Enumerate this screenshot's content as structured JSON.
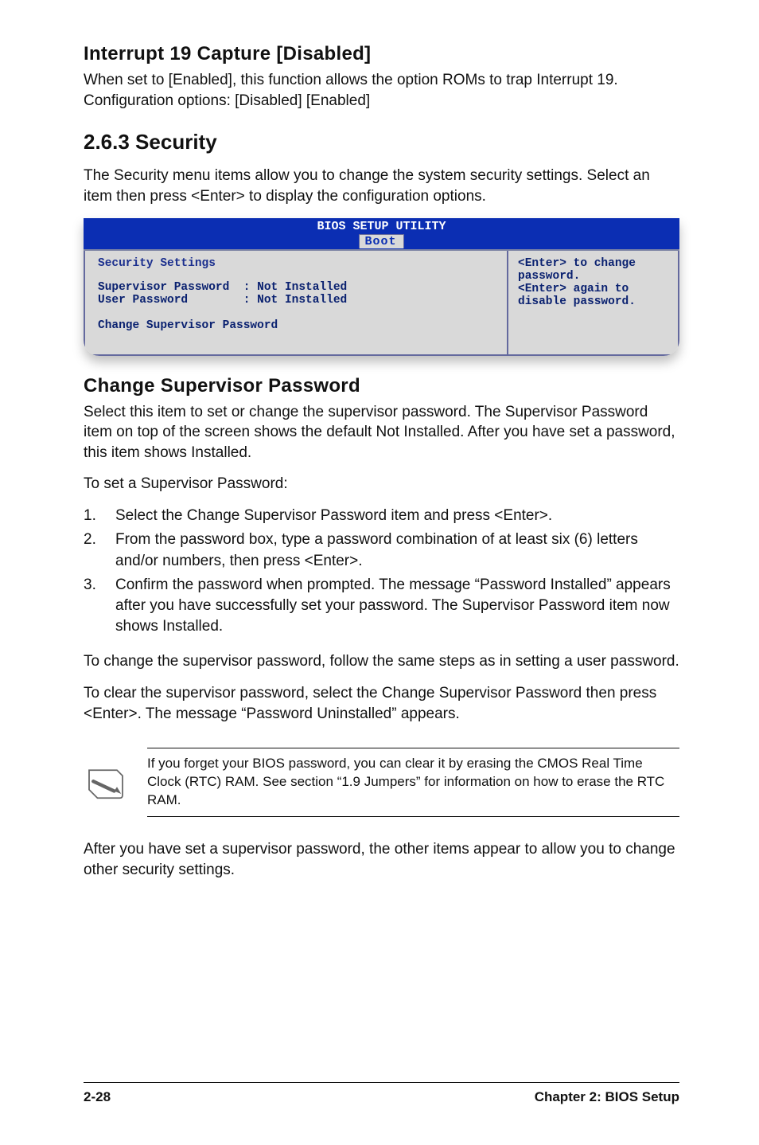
{
  "section1": {
    "heading": "Interrupt 19 Capture [Disabled]",
    "para": "When set to [Enabled], this function allows the option ROMs to trap Interrupt 19. Configuration options: [Disabled] [Enabled]"
  },
  "section2_heading": "2.6.3    Security",
  "section2_para": "The Security menu items allow you to change the system security settings. Select an item then press <Enter> to display the configuration options.",
  "bios": {
    "title": "BIOS SETUP UTILITY",
    "tab": "Boot",
    "left_title": "Security Settings",
    "row1": "Supervisor Password  : Not Installed",
    "row2": "User Password        : Not Installed",
    "change_row": "Change Supervisor Password",
    "right1": "<Enter> to change",
    "right2": "password.",
    "right3": "<Enter> again to",
    "right4": "disable password.",
    "right_hint": ""
  },
  "chg": {
    "heading": "Change Supervisor Password",
    "para1": "Select this item to set or change the supervisor password. The Supervisor Password item on top of the screen shows the default Not Installed. After you have set a password, this item shows Installed.",
    "para2": "To set a Supervisor Password:",
    "steps": [
      {
        "n": "1.",
        "t": "Select the Change Supervisor Password item and press <Enter>."
      },
      {
        "n": "2.",
        "t": "From the password box, type a password combination of at least six (6) letters and/or numbers, then press <Enter>."
      },
      {
        "n": "3.",
        "t": "Confirm the password when prompted. The message “Password Installed” appears after you have successfully set your password. The Supervisor Password item now shows Installed."
      }
    ],
    "para3": "To change the supervisor password, follow the same steps as in setting a user password.",
    "para4": "To clear the supervisor password, select the Change Supervisor Password then press <Enter>. The message “Password Uninstalled” appears."
  },
  "note": "If you forget your BIOS password, you can clear it by erasing the CMOS Real Time Clock (RTC) RAM. See section “1.9  Jumpers” for information on how to erase the RTC RAM.",
  "after_note": "After you have set a supervisor password, the other items appear to allow you to change other security settings.",
  "footer_left": "2-28",
  "footer_right": "Chapter 2: BIOS Setup"
}
